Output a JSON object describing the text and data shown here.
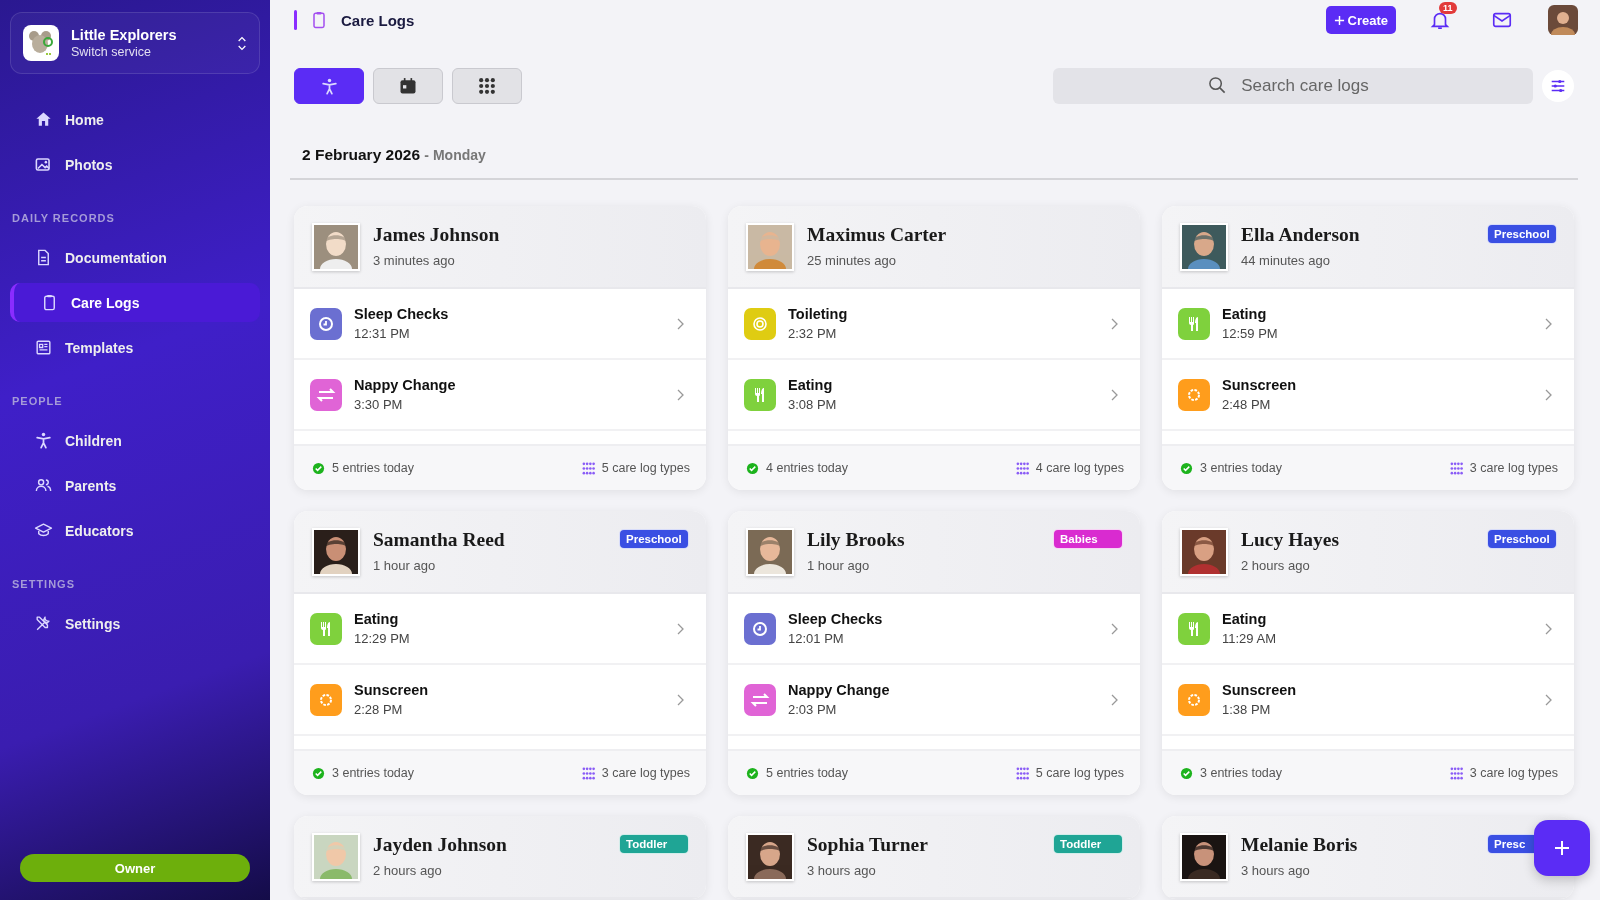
{
  "service": {
    "name": "Little Explorers",
    "subtitle": "Switch service"
  },
  "nav": [
    {
      "items": [
        {
          "label": "Home",
          "selected": false
        },
        {
          "label": "Photos",
          "selected": false
        }
      ]
    },
    {
      "heading": "DAILY RECORDS",
      "items": [
        {
          "label": "Documentation",
          "selected": false
        },
        {
          "label": "Care Logs",
          "selected": true
        },
        {
          "label": "Templates",
          "selected": false
        }
      ]
    },
    {
      "heading": "PEOPLE",
      "items": [
        {
          "label": "Children",
          "selected": false
        },
        {
          "label": "Parents",
          "selected": false
        },
        {
          "label": "Educators",
          "selected": false
        }
      ]
    },
    {
      "heading": "SETTINGS",
      "items": [
        {
          "label": "Settings",
          "selected": false
        }
      ]
    }
  ],
  "role": "Owner",
  "page_title": "Care Logs",
  "create_label": "Create",
  "notifications": "11",
  "views": [
    {
      "selected": true
    },
    {
      "selected": false
    },
    {
      "selected": false
    }
  ],
  "search": {
    "placeholder": "Search care logs"
  },
  "date": "2 February 2026",
  "weekday": "- Monday",
  "cards": [
    {
      "name": "James Johnson",
      "time": "3 minutes ago",
      "entries": [
        {
          "kind": "sleep",
          "title": "Sleep Checks",
          "time": "12:31 PM"
        },
        {
          "kind": "nappy",
          "title": "Nappy Change",
          "time": "3:30 PM"
        }
      ],
      "count": "5 entries today",
      "types": "5 care log types"
    },
    {
      "name": "Maximus Carter",
      "time": "25 minutes ago",
      "entries": [
        {
          "kind": "toilet",
          "title": "Toileting",
          "time": "2:32 PM"
        },
        {
          "kind": "eating",
          "title": "Eating",
          "time": "3:08 PM"
        }
      ],
      "count": "4 entries today",
      "types": "4 care log types"
    },
    {
      "name": "Ella Anderson",
      "time": "44 minutes ago",
      "badge": {
        "label": "Preschool",
        "color": "#3a4fe3"
      },
      "entries": [
        {
          "kind": "eating",
          "title": "Eating",
          "time": "12:59 PM"
        },
        {
          "kind": "sun",
          "title": "Sunscreen",
          "time": "2:48 PM"
        }
      ],
      "count": "3 entries today",
      "types": "3 care log types"
    },
    {
      "name": "Samantha Reed",
      "time": "1 hour ago",
      "badge": {
        "label": "Preschool",
        "color": "#3a4fe3"
      },
      "entries": [
        {
          "kind": "eating",
          "title": "Eating",
          "time": "12:29 PM"
        },
        {
          "kind": "sun",
          "title": "Sunscreen",
          "time": "2:28 PM"
        }
      ],
      "count": "3 entries today",
      "types": "3 care log types"
    },
    {
      "name": "Lily Brooks",
      "time": "1 hour ago",
      "badge": {
        "label": "Babies",
        "color": "#d92bd0"
      },
      "entries": [
        {
          "kind": "sleep",
          "title": "Sleep Checks",
          "time": "12:01 PM"
        },
        {
          "kind": "nappy",
          "title": "Nappy Change",
          "time": "2:03 PM"
        }
      ],
      "count": "5 entries today",
      "types": "5 care log types"
    },
    {
      "name": "Lucy Hayes",
      "time": "2 hours ago",
      "badge": {
        "label": "Preschool",
        "color": "#3a4fe3"
      },
      "entries": [
        {
          "kind": "eating",
          "title": "Eating",
          "time": "11:29 AM"
        },
        {
          "kind": "sun",
          "title": "Sunscreen",
          "time": "1:38 PM"
        }
      ],
      "count": "3 entries today",
      "types": "3 care log types"
    },
    {
      "name": "Jayden Johnson",
      "time": "2 hours ago",
      "badge": {
        "label": "Toddler",
        "color": "#1fa595"
      }
    },
    {
      "name": "Sophia Turner",
      "time": "3 hours ago",
      "badge": {
        "label": "Toddler",
        "color": "#1fa595"
      }
    },
    {
      "name": "Melanie Boris",
      "time": "3 hours ago",
      "badge": {
        "label": "Presc",
        "color": "#3a4fe3"
      }
    }
  ]
}
